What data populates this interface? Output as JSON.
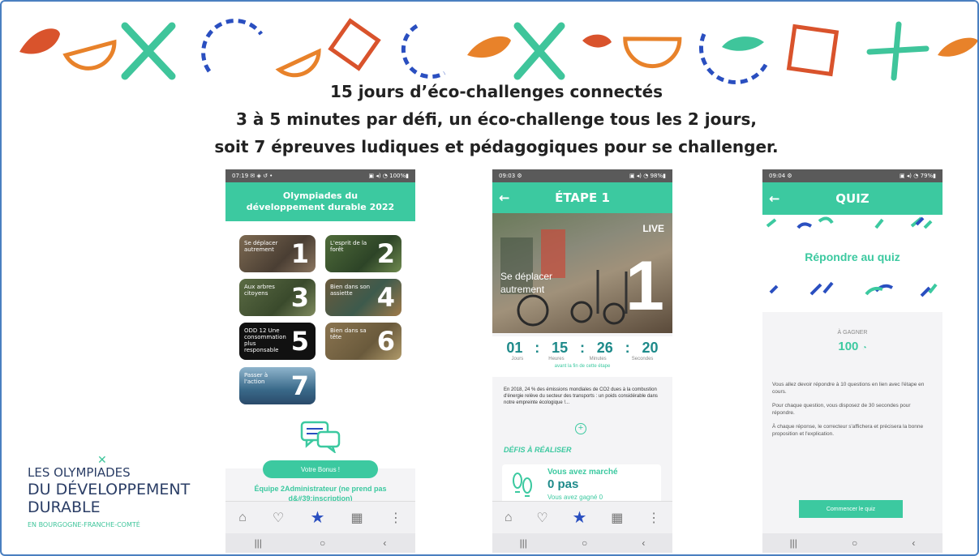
{
  "headline": {
    "line1": "15 jours  d’éco-challenges connectés",
    "line2": "3 à 5 minutes par défi, un éco-challenge tous les 2 jours,",
    "line3": "soit 7 épreuves ludiques et pédagogiques pour se challenger."
  },
  "phone1": {
    "status_left": "07:19 ✉ ◈ ↺ •",
    "status_right": "▣ ◂) ◔ 100%▮",
    "title": "Olympiades du développement durable 2022",
    "tiles": [
      {
        "label": "Se déplacer autrement",
        "num": "1"
      },
      {
        "label": "L'esprit de la forêt",
        "num": "2"
      },
      {
        "label": "Aux arbres citoyens",
        "num": "3"
      },
      {
        "label": "Bien dans son assiette",
        "num": "4"
      },
      {
        "label": "ODD 12 Une consommation plus responsable",
        "num": "5"
      },
      {
        "label": "Bien dans sa tête",
        "num": "6"
      },
      {
        "label": "Passer à l'action",
        "num": "7"
      }
    ],
    "score_button": "Votre Bonus !",
    "team_text": "Équipe 2Administrateur (ne prend pas d&#39;inscription)"
  },
  "phone2": {
    "status_left": "09:03 ⚙",
    "status_right": "▣ ◂) ◔ 98%▮",
    "title": "ÉTAPE 1",
    "live_label": "LIVE",
    "hero_text": "Se déplacer autrement",
    "hero_num": "1",
    "countdown": [
      {
        "value": "01",
        "unit": "Jours"
      },
      {
        "value": "15",
        "unit": "Heures"
      },
      {
        "value": "26",
        "unit": "Minutes"
      },
      {
        "value": "20",
        "unit": "Secondes"
      }
    ],
    "countdown_caption": "avant la fin de cette étape",
    "body": "En 2018, 24 % des émissions mondiales de CO2 dues à la combustion d'énergie relève du secteur des transports : un poids considérable dans notre empreinte écologique !...",
    "section_title": "DÉFIS À RÉALISER",
    "walk_title": "Vous avez marché",
    "walk_value": "0 pas",
    "walk_sub": "Vous avez gagné  0"
  },
  "phone3": {
    "status_left": "09:04 ⚙",
    "status_right": "▣ ◂) ◔ 79%▮",
    "title": "QUIZ",
    "banner_title": "Répondre au quiz",
    "points_label": "À GAGNER",
    "points_value": "100",
    "p1": "Vous allez devoir répondre à 10 questions en lien avec l'étape en cours.",
    "p2": "Pour chaque question, vous disposez de 30 secondes pour répondre.",
    "p3": "À chaque réponse, le correcteur s'affichera et précisera la bonne proposition et l'explication.",
    "button": "Commencer le quiz"
  },
  "logo": {
    "line1": "LES OLYMPIADES",
    "line2": "DU DÉVELOPPEMENT",
    "line3": "DURABLE",
    "line4": "EN BOURGOGNE-FRANCHE-COMTÉ"
  },
  "colors": {
    "teal": "#3cc9a0",
    "orange": "#e8822a",
    "red": "#d9532c",
    "blue": "#2a4fc0",
    "green": "#3fc59b"
  }
}
